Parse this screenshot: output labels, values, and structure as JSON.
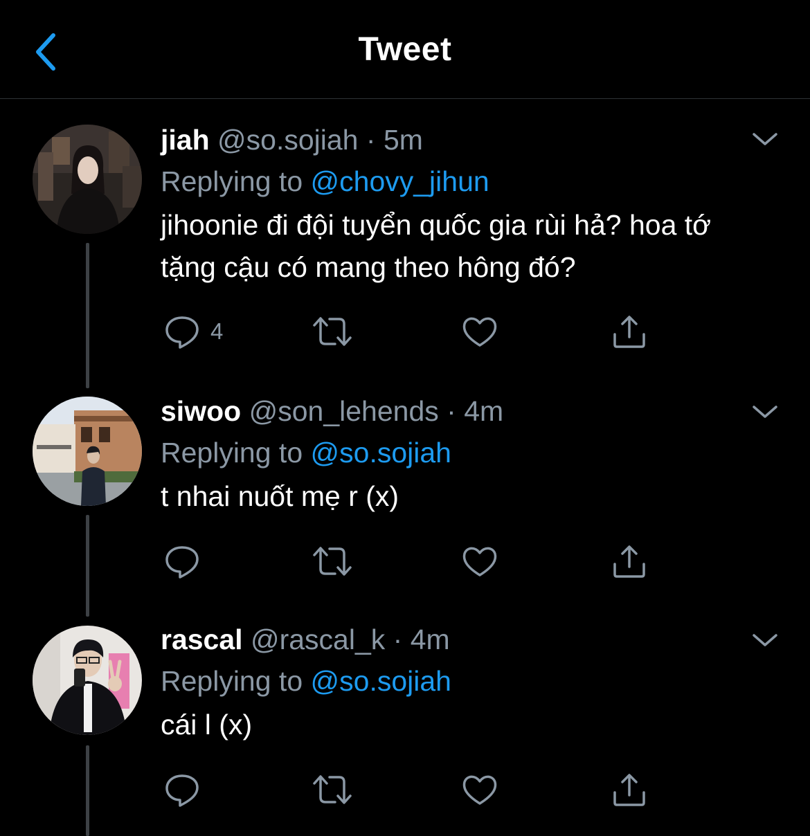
{
  "header": {
    "title": "Tweet",
    "back_icon": "chevron-left-icon",
    "accent_color": "#1d9bf0"
  },
  "tweets": [
    {
      "name": "jiah",
      "handle": "@so.sojiah",
      "separator": "·",
      "time": "5m",
      "replying_prefix": "Replying to",
      "replying_to": "@chovy_jihun",
      "text": "jihoonie đi đội tuyển quốc gia rùi hả? hoa tớ tặng cậu có mang theo hông đó?",
      "reply_count": "4"
    },
    {
      "name": "siwoo",
      "handle": "@son_lehends",
      "separator": "·",
      "time": "4m",
      "replying_prefix": "Replying to",
      "replying_to": "@so.sojiah",
      "text": "t nhai nuốt mẹ r (x)",
      "reply_count": ""
    },
    {
      "name": "rascal",
      "handle": "@rascal_k",
      "separator": "·",
      "time": "4m",
      "replying_prefix": "Replying to",
      "replying_to": "@so.sojiah",
      "text": "cái l (x)",
      "reply_count": ""
    }
  ],
  "icons": {
    "reply": "reply-icon",
    "retweet": "retweet-icon",
    "like": "heart-icon",
    "share": "share-icon",
    "more": "chevron-down-icon"
  }
}
